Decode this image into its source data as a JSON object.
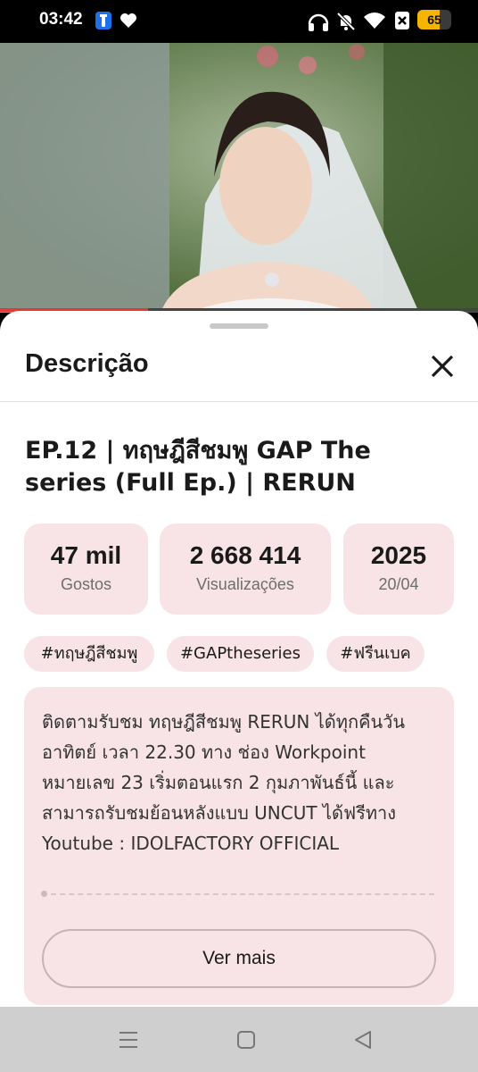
{
  "status_bar": {
    "time": "03:42",
    "battery_level": "65",
    "battery_fraction": 0.65,
    "icons": [
      "key-app-icon",
      "heart-icon",
      "headphones-icon",
      "bell-muted-icon",
      "wifi-icon",
      "sim-x-icon",
      "battery-icon"
    ]
  },
  "video": {
    "progress_fraction": 0.31,
    "progress_color": "#e53935"
  },
  "sheet": {
    "title": "Descrição",
    "video_title": "EP.12  |  ทฤษฎีสีชมพู GAP The series (Full Ep.)  |  RERUN",
    "stats": [
      {
        "value": "47 mil",
        "label": "Gostos"
      },
      {
        "value": "2 668 414",
        "label": "Visualizações"
      },
      {
        "value": "2025",
        "label": "20/04"
      }
    ],
    "hashtags": [
      "#ทฤษฎีสีชมพู",
      "#GAPtheseries",
      "#ฟรีนเบค"
    ],
    "description": "ติดตามรับชม ทฤษฎีสีชมพู RERUN ได้ทุกคืนวันอาทิตย์ เวลา 22.30 ทาง ช่อง Workpoint หมายเลข 23 เริ่มตอนแรก 2 กุมภาพันธ์นี้ และสามารถรับชมย้อนหลังแบบ UNCUT ได้ฟรีทาง Youtube : IDOLFACTORY OFFICIAL",
    "more_button": "Ver mais"
  },
  "colors": {
    "card_bg": "#f8e4e7",
    "battery": "#f5b400"
  },
  "nav_bar": {
    "icons": [
      "menu-icon",
      "home-square-icon",
      "back-triangle-icon"
    ]
  }
}
